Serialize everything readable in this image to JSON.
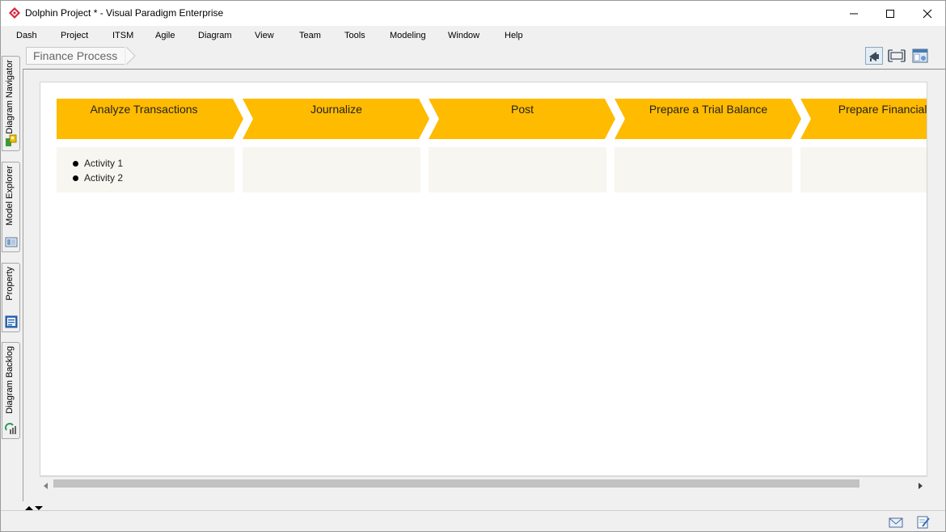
{
  "window": {
    "title": "Dolphin Project * - Visual Paradigm Enterprise"
  },
  "menu": {
    "items": [
      "Dash",
      "Project",
      "ITSM",
      "Agile",
      "Diagram",
      "View",
      "Team",
      "Tools",
      "Modeling",
      "Window",
      "Help"
    ]
  },
  "side_tabs": [
    {
      "label": "Diagram Navigator",
      "icon": "diagram-navigator-icon"
    },
    {
      "label": "Model Explorer",
      "icon": "model-explorer-icon"
    },
    {
      "label": "Property",
      "icon": "property-icon"
    },
    {
      "label": "Diagram Backlog",
      "icon": "diagram-backlog-icon"
    }
  ],
  "breadcrumb": {
    "label": "Finance Process"
  },
  "toolbar": {
    "icons": [
      "announce-icon",
      "fit-diagram-icon",
      "layer-icon"
    ]
  },
  "process": {
    "stages": [
      {
        "label": "Analyze Transactions",
        "activities": [
          "Activity 1",
          "Activity 2"
        ]
      },
      {
        "label": "Journalize",
        "activities": []
      },
      {
        "label": "Post",
        "activities": []
      },
      {
        "label": "Prepare a Trial Balance",
        "activities": []
      },
      {
        "label": "Prepare Financial Stat",
        "activities": []
      }
    ]
  },
  "colors": {
    "stage_head": "#FFBB00",
    "stage_body": "#F8F6F0",
    "app_icon": "#D7263D"
  }
}
